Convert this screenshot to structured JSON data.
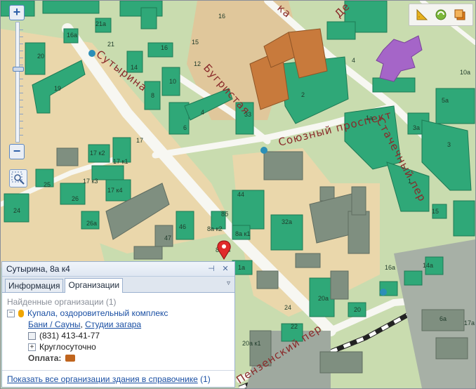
{
  "map": {
    "streets": [
      "Сутырина",
      "Бугристая",
      "Союзный проспект",
      "Стачечный пер",
      "Пензенский пер",
      "ка",
      "Де"
    ],
    "building_numbers": [
      "16",
      "15",
      "21а",
      "21",
      "16а",
      "20",
      "19",
      "14",
      "16",
      "12",
      "10",
      "8",
      "6",
      "4",
      "2",
      "33",
      "17",
      "17 к2",
      "17 к1",
      "17 к3",
      "17 к4",
      "25",
      "26",
      "24",
      "26а",
      "44",
      "46",
      "47",
      "8а к2",
      "8а к1",
      "8а к4",
      "8б",
      "32а",
      "1а",
      "16а",
      "14а",
      "20а",
      "20",
      "24",
      "22",
      "20а к1",
      "6а",
      "17а",
      "15",
      "1",
      "3а",
      "3",
      "5а",
      "1а",
      "10а",
      "4"
    ],
    "colors": {
      "park": "#c9dcaf",
      "residential": "#ead7ab",
      "building": "#2fa878",
      "industrial": "#7f8f80",
      "school": "#c87a3c",
      "landmark": "#a565c8",
      "street_label": "#8a2a2a"
    }
  },
  "controls": {
    "zoom_in": "+",
    "zoom_out": "−",
    "zoom_level": 0.62,
    "zoom_area_icon": "magnifier-area-icon",
    "tools": [
      "ruler-icon",
      "traffic-icon",
      "layers-icon"
    ]
  },
  "panel": {
    "title": "Сутырина, 8а к4",
    "pin_icon": "pin-icon",
    "close_icon": "close-icon",
    "tabs": [
      "Информация",
      "Организации"
    ],
    "active_tab": 1,
    "found_label": "Найденные организации (1)",
    "org_name": "Купала, оздоровительный комплекс",
    "categories": [
      "Бани / Сауны",
      "Студии загара"
    ],
    "category_sep": ", ",
    "phone": "(831) 413-41-77",
    "hours": "Круглосуточно",
    "payment_label": "Оплата:",
    "footer_link": "Показать все организации здания в справочнике",
    "footer_count": "(1)"
  }
}
